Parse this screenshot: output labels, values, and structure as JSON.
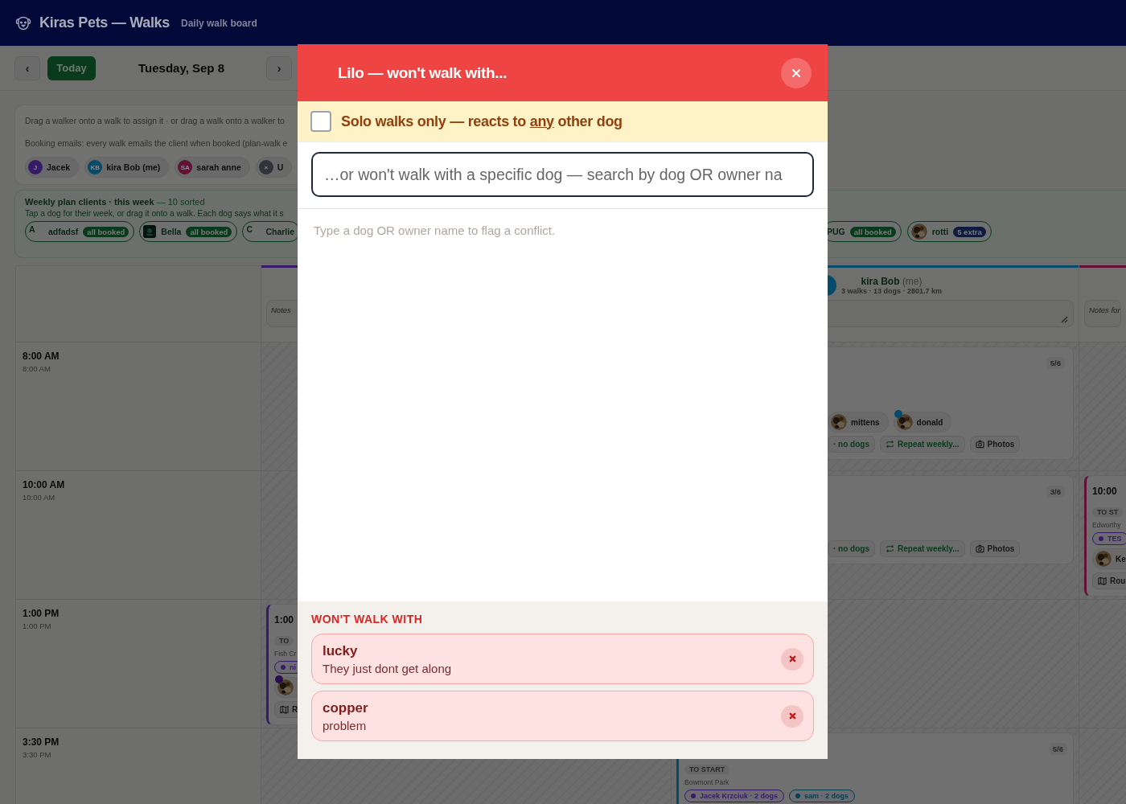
{
  "header": {
    "title": "Kiras Pets — Walks",
    "subtitle": "Daily walk board"
  },
  "toolbar": {
    "prev": "‹",
    "today": "Today",
    "date": "Tuesday, Sep 8",
    "next": "›"
  },
  "info": {
    "instruction": "Drag a walker onto a walk to assign it · or drag a walk onto a walker to",
    "booking_note": "Booking emails: every walk emails the client when booked (plan-walk e",
    "walkers": [
      {
        "initials": "J",
        "name": "Jacek",
        "color": "#381a6b"
      },
      {
        "initials": "KB",
        "name": "kira Bob (me)",
        "color": "#064a69"
      },
      {
        "initials": "SA",
        "name": "sarah anne",
        "color": "#631236"
      },
      {
        "initials": "×",
        "name": "U",
        "color": "#303339"
      }
    ]
  },
  "weekly_plan": {
    "title": "Weekly plan clients · this week",
    "count": "— 10 sorted",
    "hint": "Tap a dog for their week, or drag it onto a walk. Each dog says what it s",
    "dogs": [
      {
        "name": "adfadsf",
        "kind": "letter",
        "letter": "A",
        "badge": {
          "label": "all booked",
          "kind": "booked"
        }
      },
      {
        "name": "Bella",
        "kind": "tile",
        "badge": {
          "label": "all booked",
          "kind": "booked"
        }
      },
      {
        "name": "Charlie",
        "kind": "letter",
        "letter": "C"
      },
      {
        "name": "PUG",
        "kind": "hidden",
        "badge": {
          "label": "all booked",
          "kind": "booked"
        }
      },
      {
        "name": "rotti",
        "badge": {
          "label": "5 extra",
          "kind": "extra"
        }
      }
    ]
  },
  "schedule": {
    "columns": [
      {
        "color": "#381a6b",
        "notes_placeholder": "Notes"
      },
      {
        "color": "#064a69",
        "walker": {
          "name": "kira Bob",
          "suffix": "(me)",
          "stats": "3 walks · 13 dogs · 2801.7 km"
        }
      },
      {
        "color": "#631236",
        "notes_placeholder": "Notes for"
      }
    ],
    "rows": [
      {
        "time": "8:00 AM",
        "subtime": "8:00 AM",
        "cells": [
          {
            "kind": "empty"
          },
          {
            "kind": "walk_partial",
            "count": "5/6",
            "dogs": [
              {
                "name": "mittens"
              },
              {
                "name": "donald",
                "color": "#064a69"
              }
            ],
            "actions": [
              {
                "kind": "text",
                "label": "· no dogs"
              },
              {
                "kind": "repeat",
                "label": "Repeat weekly..."
              },
              {
                "kind": "photos",
                "label": "Photos"
              }
            ]
          },
          {
            "kind": "empty"
          }
        ]
      },
      {
        "time": "10:00 AM",
        "subtime": "10:00 AM",
        "cells": [
          {
            "kind": "empty"
          },
          {
            "kind": "walk_partial",
            "count": "3/6",
            "actions": [
              {
                "kind": "text",
                "label": "· no dogs"
              },
              {
                "kind": "repeat",
                "label": "Repeat weekly..."
              },
              {
                "kind": "photos",
                "label": "Photos"
              }
            ]
          },
          {
            "kind": "walk",
            "time": "10:00",
            "status": "TO ST",
            "place": "Edworthy",
            "walkers": [
              {
                "name": "TES",
                "color": "#381a6b"
              }
            ],
            "dogs": [
              {
                "name": "Ke"
              }
            ],
            "actions": [
              {
                "kind": "route",
                "label": "Rou"
              }
            ]
          }
        ]
      },
      {
        "time": "1:00 PM",
        "subtime": "1:00 PM",
        "cells": [
          {
            "kind": "walk",
            "time": "1:00",
            "status": "TO",
            "place": "Fish Cr",
            "walkers": [
              {
                "name": "ni",
                "color": "#381a6b"
              }
            ],
            "dogs": [
              {
                "color": "#290f52"
              }
            ],
            "actions": [
              {
                "kind": "route",
                "label": "R"
              }
            ]
          },
          {
            "kind": "empty"
          },
          {
            "kind": "empty"
          }
        ]
      },
      {
        "time": "3:30 PM",
        "subtime": "3:30 PM",
        "cells": [
          {
            "kind": "empty"
          },
          {
            "kind": "walk",
            "count": "5/6",
            "status": "TO START",
            "place": "Bowmont Park",
            "walkers": [
              {
                "name": "Jacek Krzciuk · 2 dogs",
                "color": "#381a6b"
              },
              {
                "name": "sam · 2 dogs",
                "color": "#044150"
              }
            ]
          },
          {
            "kind": "empty"
          }
        ]
      }
    ]
  },
  "dialog": {
    "title": "Lilo — won't walk with...",
    "solo": {
      "checked": false,
      "before": "Solo walks only — reacts to ",
      "emphasis": "any",
      "after": " other dog"
    },
    "search": {
      "placeholder": "…or won't walk with a specific dog — search by dog OR owner na"
    },
    "hint": "Type a dog OR owner name to flag a conflict.",
    "list_title": "WON'T WALK WITH",
    "conflicts": [
      {
        "dog": "lucky",
        "note": "They just dont get along"
      },
      {
        "dog": "copper",
        "note": "problem"
      }
    ]
  }
}
